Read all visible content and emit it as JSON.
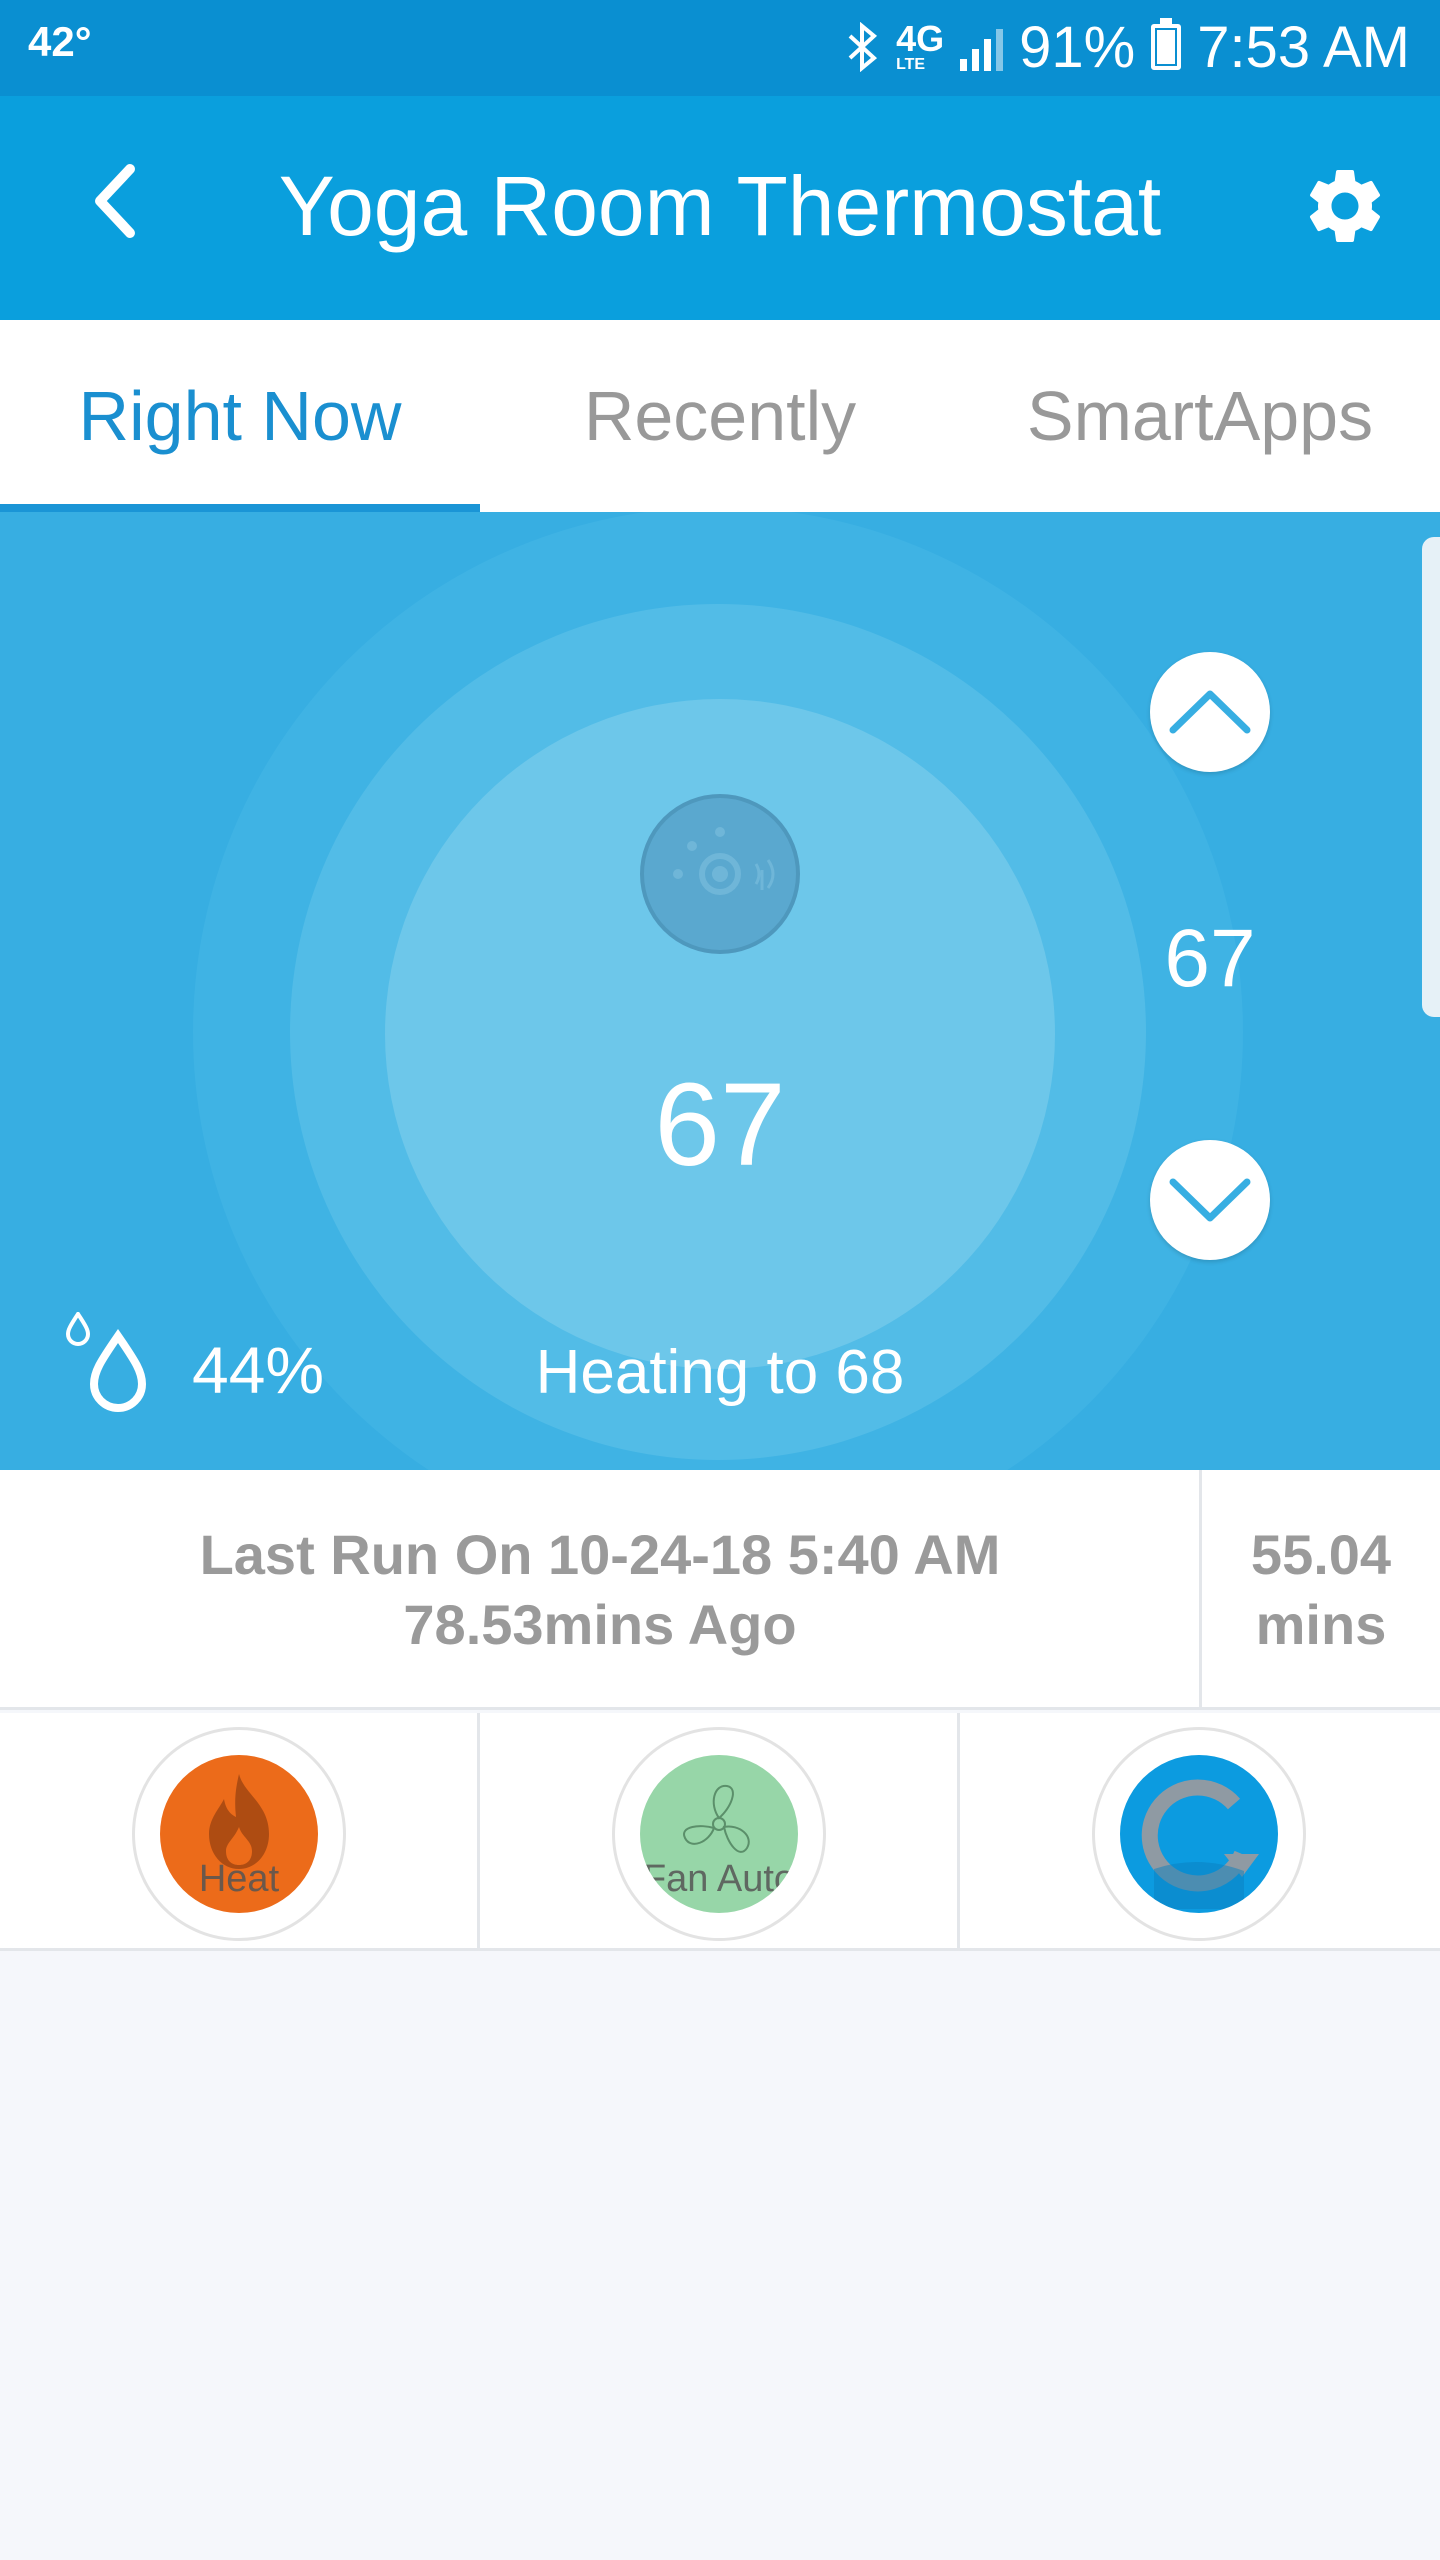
{
  "status_bar": {
    "weather": "42°",
    "network": "4G",
    "network_sub": "LTE",
    "battery": "91%",
    "time": "7:53 AM"
  },
  "header": {
    "title": "Yoga Room Thermostat",
    "back_icon": "chevron-left-icon",
    "settings_icon": "gear-icon"
  },
  "tabs": [
    {
      "label": "Right Now",
      "active": true
    },
    {
      "label": "Recently",
      "active": false
    },
    {
      "label": "SmartApps",
      "active": false
    }
  ],
  "thermostat": {
    "current_temp": "67",
    "setpoint": "67",
    "humidity": "44%",
    "status": "Heating to 68"
  },
  "last_run": {
    "line1": "Last Run On 10-24-18 5:40 AM",
    "line2": "78.53mins Ago",
    "duration_value": "55.04",
    "duration_unit": "mins"
  },
  "modes": [
    {
      "label": "Heat",
      "icon": "flame-icon",
      "color": "#ec6b1a"
    },
    {
      "label": "Fan Auto",
      "icon": "fan-icon",
      "color": "#97d6a8"
    },
    {
      "label": "",
      "icon": "refresh-icon",
      "color": "#0c9be0"
    }
  ],
  "colors": {
    "header": "#0a9fdd",
    "status_bar": "#0a8fd1",
    "panel": "#37aee2",
    "accent": "#1a8fd0"
  }
}
